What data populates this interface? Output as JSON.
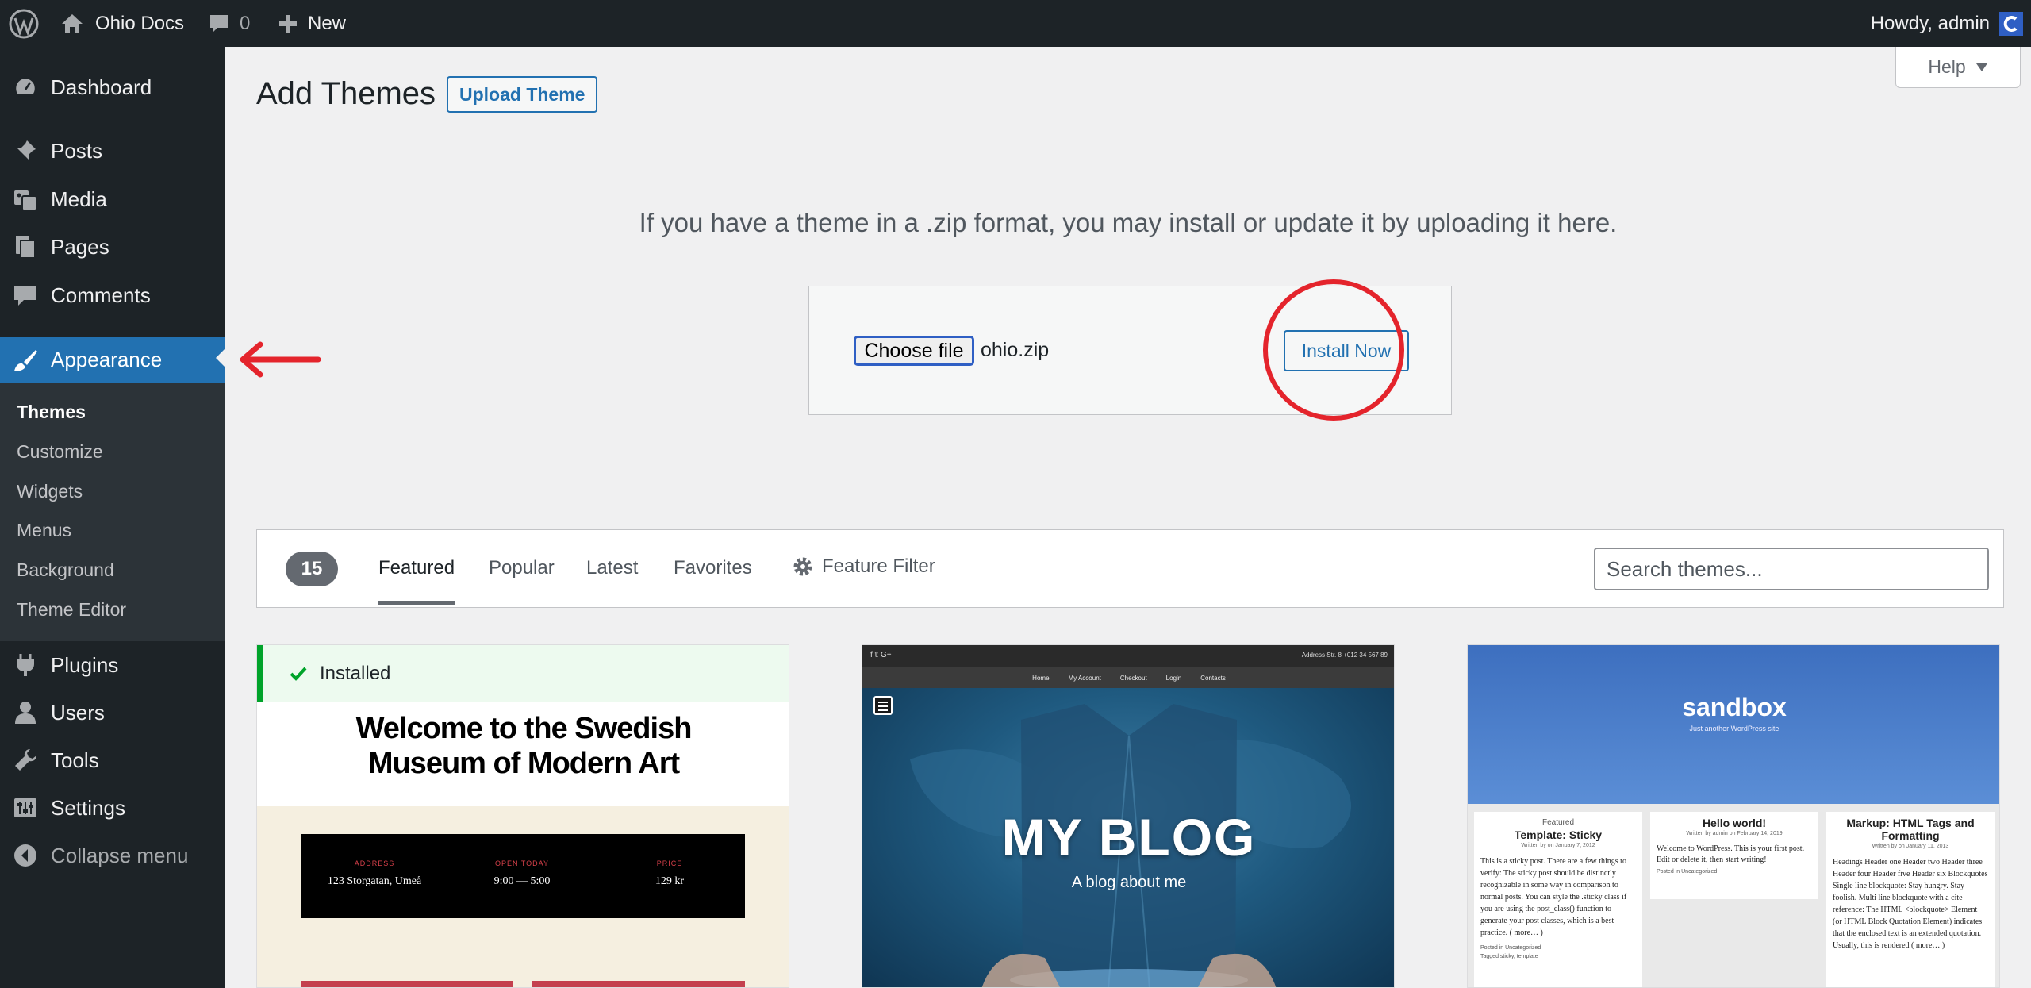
{
  "adminbar": {
    "site_name": "Ohio Docs",
    "comments_count": "0",
    "new_label": "New",
    "greeting": "Howdy, admin"
  },
  "sidebar": {
    "items": [
      {
        "label": "Dashboard",
        "icon": "dashboard-icon"
      },
      {
        "label": "Posts",
        "icon": "pin-icon"
      },
      {
        "label": "Media",
        "icon": "media-icon"
      },
      {
        "label": "Pages",
        "icon": "pages-icon"
      },
      {
        "label": "Comments",
        "icon": "comments-icon"
      },
      {
        "label": "Appearance",
        "icon": "brush-icon",
        "current": true
      },
      {
        "label": "Plugins",
        "icon": "plugin-icon"
      },
      {
        "label": "Users",
        "icon": "users-icon"
      },
      {
        "label": "Tools",
        "icon": "wrench-icon"
      },
      {
        "label": "Settings",
        "icon": "settings-icon"
      },
      {
        "label": "Collapse menu",
        "icon": "collapse-icon"
      }
    ],
    "submenu": [
      "Themes",
      "Customize",
      "Widgets",
      "Menus",
      "Background",
      "Theme Editor"
    ]
  },
  "header": {
    "title": "Add Themes",
    "upload_button": "Upload Theme",
    "help": "Help"
  },
  "upload": {
    "description": "If you have a theme in a .zip format, you may install or update it by uploading it here.",
    "choose_file": "Choose file",
    "file_name": "ohio.zip",
    "install_button": "Install Now"
  },
  "filter": {
    "count": "15",
    "tabs": [
      "Featured",
      "Popular",
      "Latest",
      "Favorites"
    ],
    "active_tab": "Featured",
    "feature_filter": "Feature Filter",
    "search_placeholder": "Search themes..."
  },
  "themes": {
    "card1": {
      "installed_label": "Installed",
      "headline": "Welcome to the Swedish Museum of Modern Art",
      "info": [
        {
          "label": "ADDRESS",
          "value": "123 Storgatan, Umeå"
        },
        {
          "label": "OPEN TODAY",
          "value": "9:00 — 5:00"
        },
        {
          "label": "PRICE",
          "value": "129 kr"
        }
      ]
    },
    "card2": {
      "topbar_left": "f  𝕥  G+",
      "topbar_right": "Address Str. 8    +012 34 567 89",
      "nav": [
        "Home",
        "My Account",
        "Checkout",
        "Login",
        "Contacts"
      ],
      "title": "MY BLOG",
      "tagline": "A blog about me"
    },
    "card3": {
      "site_title": "sandbox",
      "site_tagline": "Just another WordPress site",
      "col1": {
        "kicker": "Featured",
        "title": "Template: Sticky",
        "meta": "Written by on January 7, 2012",
        "body": "This is a sticky post. There are a few things to verify: The sticky post should be distinctly recognizable in some way in comparison to normal posts. You can style the .sticky class if you are using the post_class() function to generate your post classes, which is a best practice. ( more… )",
        "footer1": "Posted in Uncategorized",
        "footer2": "Tagged sticky, template"
      },
      "col2": {
        "title": "Hello world!",
        "meta": "Written by admin on February 14, 2019",
        "body": "Welcome to WordPress. This is your first post. Edit or delete it, then start writing!",
        "footer": "Posted in Uncategorized"
      },
      "col3": {
        "title": "Markup: HTML Tags and Formatting",
        "meta": "Written by on January 11, 2013",
        "body": "Headings Header one Header two Header three Header four Header five Header six Blockquotes Single line blockquote: Stay hungry. Stay foolish. Multi line blockquote with a cite reference: The HTML <blockquote> Element (or HTML Block Quotation Element) indicates that the enclosed text is an extended quotation. Usually, this is rendered ( more… )"
      }
    }
  },
  "colors": {
    "admin_dark": "#1d2327",
    "accent": "#2271b1",
    "annotation": "#e4242c"
  }
}
